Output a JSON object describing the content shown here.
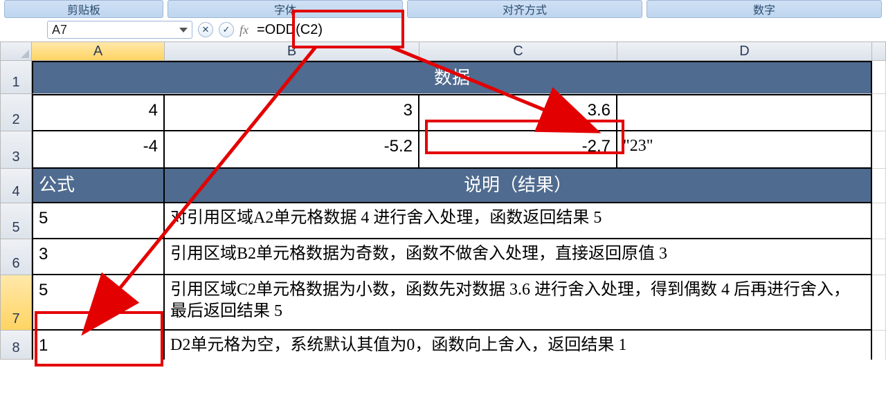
{
  "ribbon": {
    "groups": [
      "剪贴板",
      "字体",
      "对齐方式",
      "数字"
    ]
  },
  "namebox": {
    "value": "A7"
  },
  "fx_label": "fx",
  "formula": "=ODD(C2)",
  "columns": [
    "A",
    "B",
    "C",
    "D"
  ],
  "rows": [
    "1",
    "2",
    "3",
    "4",
    "5",
    "6",
    "7",
    "8"
  ],
  "table": {
    "header1": "数据",
    "r2": {
      "a": "4",
      "b": "3",
      "c": "3.6",
      "d": ""
    },
    "r3": {
      "a": "-4",
      "b": "-5.2",
      "c": "-2.7",
      "d": "\"23\""
    },
    "header4_a": "公式",
    "header4_rest": "说明（结果）",
    "r5": {
      "a": "5",
      "b": "对引用区域A2单元格数据 4 进行舍入处理，函数返回结果 5"
    },
    "r6": {
      "a": "3",
      "b": "引用区域B2单元格数据为奇数，函数不做舍入处理，直接返回原值 3"
    },
    "r7": {
      "a": "5",
      "b": "引用区域C2单元格数据为小数，函数先对数据 3.6 进行舍入处理，得到偶数 4 后再进行舍入，最后返回结果 5"
    },
    "r8": {
      "a": "1",
      "b": "D2单元格为空，系统默认其值为0，函数向上舍入，返回结果 1"
    }
  }
}
